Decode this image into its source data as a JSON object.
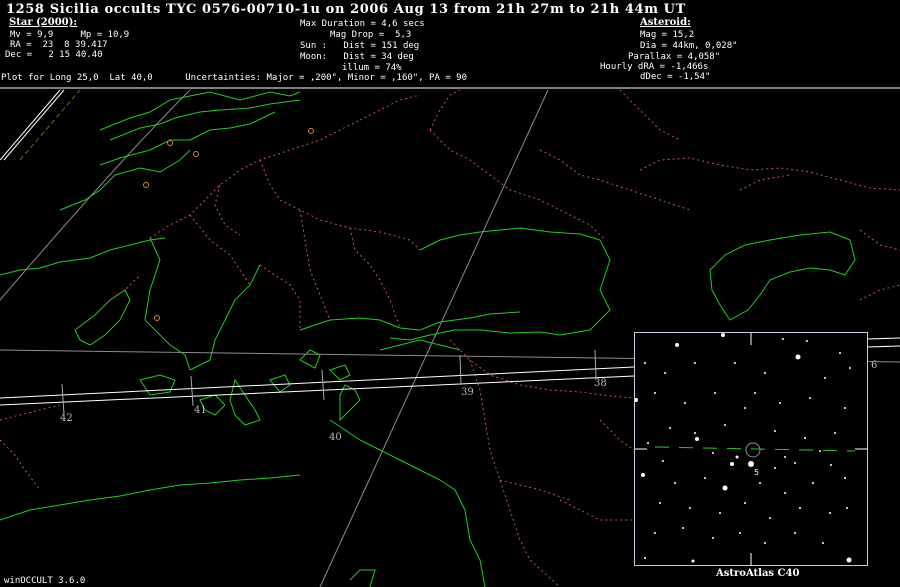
{
  "title": "1258 Sicilia occults TYC 0576-00710-1u on 2006 Aug 13 from 21h 27m to 21h 44m UT",
  "star": {
    "header": "Star (2000):",
    "lines": [
      "Mv = 9,9     Mp = 10,9",
      "RA =  23  8 39.417",
      "Dec =   2 15 40.40"
    ]
  },
  "event": {
    "lines": [
      "Max Duration = 4,6 secs",
      "Mag Drop =  5,3",
      "Sun :   Dist = 151 deg",
      "Moon:   Dist = 34 deg",
      "illum = 74%"
    ]
  },
  "asteroid": {
    "header": "Asteroid:",
    "lines": [
      "Mag = 15,2",
      "Dia = 44km, 0,028\"",
      "Parallax = 4,058\"",
      "Hourly dRA = -1,466s",
      "dDec = -1,54\""
    ]
  },
  "plot_line": "Plot for Long 25,0  Lat 40,0      Uncertainties: Major = ,200\", Minor = ,160\", PA = 90",
  "longitude_ticks": [
    "42",
    "41",
    "40",
    "39",
    "38",
    "6"
  ],
  "inset": {
    "label": "AstroAtlas C40",
    "marker": "5"
  },
  "footer": "winOCCULT 3.6.0",
  "colors": {
    "coast": "#22cc22",
    "border": "#cc5555",
    "path": "#ffffff",
    "grid": "#8c8c8c",
    "city": "#e08020",
    "inset_border": "#c8c8e8"
  }
}
